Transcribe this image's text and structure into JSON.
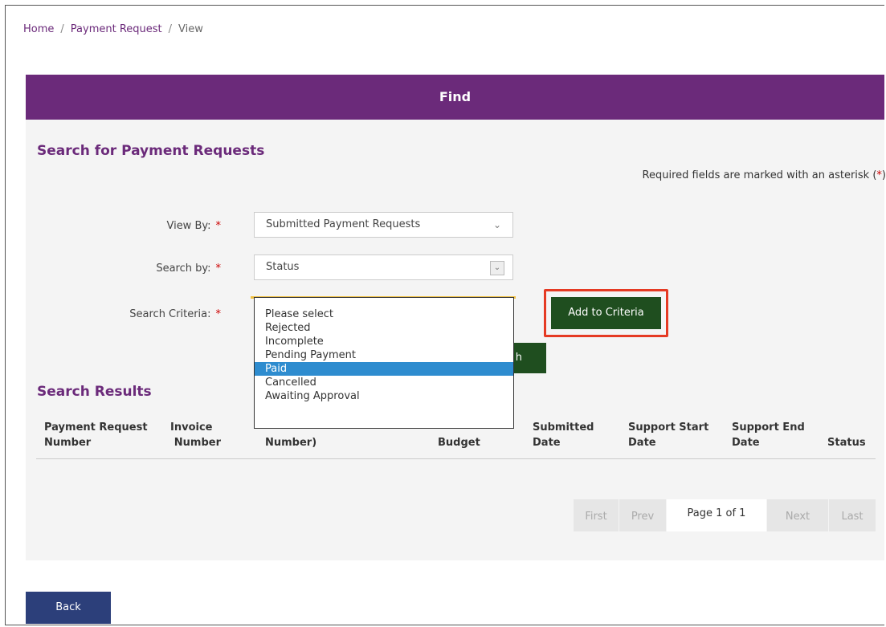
{
  "breadcrumb": {
    "home": "Home",
    "payment_request": "Payment Request",
    "view": "View",
    "sep": "/"
  },
  "panel": {
    "header": "Find"
  },
  "search": {
    "title": "Search for Payment Requests",
    "required_note_prefix": "Required fields are marked with an asterisk (",
    "required_note_star": "*",
    "required_note_suffix": ")",
    "view_by_label": "View By:",
    "view_by_value": "Submitted Payment Requests",
    "search_by_label": "Search by:",
    "search_by_value": "Status",
    "criteria_label": "Search Criteria:",
    "required_star": "*",
    "criteria_options": [
      "Please select",
      "Rejected",
      "Incomplete",
      "Pending Payment",
      "Paid",
      "Cancelled",
      "Awaiting Approval"
    ],
    "criteria_highlighted": "Paid",
    "add_to_criteria": "Add to Criteria",
    "search_button_visible_fragment": "h"
  },
  "results": {
    "title": "Search Results",
    "columns": [
      {
        "line1": "Payment Request",
        "line2": "Number"
      },
      {
        "line1": "Invoice",
        "line2": "Number"
      },
      {
        "line1": "",
        "line2": "Number)"
      },
      {
        "line1": "",
        "line2": "Budget"
      },
      {
        "line1": "Submitted",
        "line2": "Date"
      },
      {
        "line1": "Support Start",
        "line2": "Date"
      },
      {
        "line1": "Support End",
        "line2": "Date"
      },
      {
        "line1": "",
        "line2": "Status"
      }
    ]
  },
  "pager": {
    "first": "First",
    "prev": "Prev",
    "page": "Page 1 of 1",
    "next": "Next",
    "last": "Last"
  },
  "footer": {
    "back": "Back"
  },
  "colors": {
    "purple": "#6b2a7a",
    "dark_green": "#1f4e1f",
    "navy": "#2c3f7a",
    "highlight_red": "#e53a23",
    "selected_blue": "#2e8ccf"
  }
}
